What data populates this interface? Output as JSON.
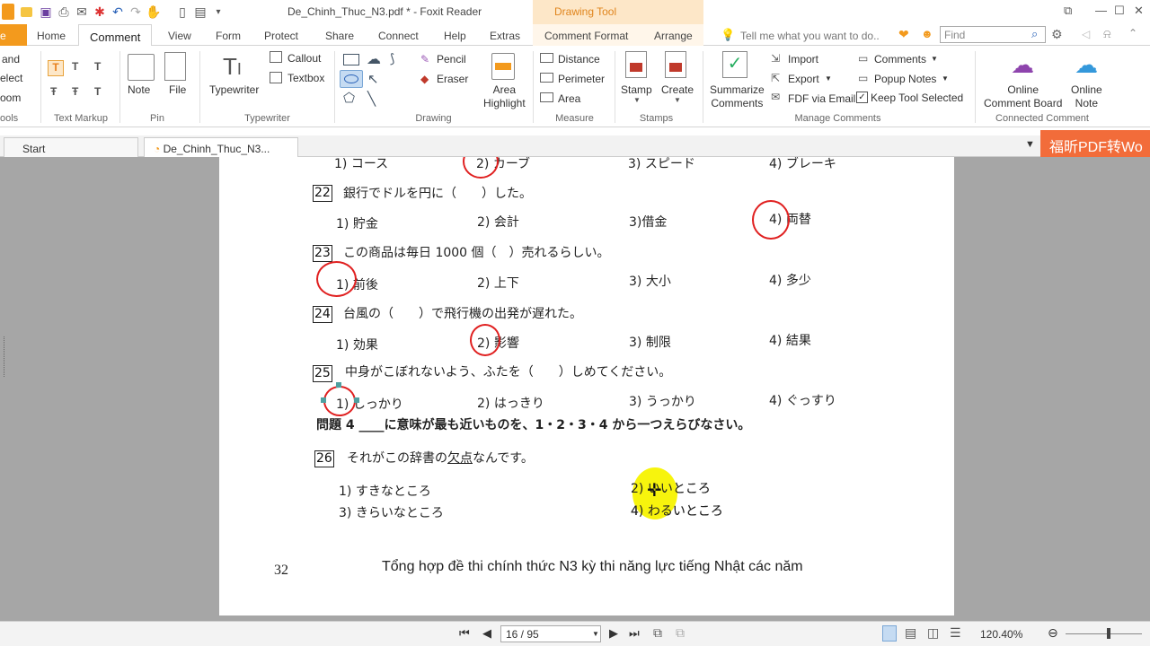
{
  "app": {
    "title": "De_Chinh_Thuc_N3.pdf * - Foxit Reader",
    "context_tab": "Drawing Tool"
  },
  "menu_tabs": [
    "e",
    "Home",
    "Comment",
    "View",
    "Form",
    "Protect",
    "Share",
    "Connect",
    "Help",
    "Extras",
    "Comment Format",
    "Arrange"
  ],
  "tell_me": "Tell me what you want to do..",
  "search": {
    "placeholder": "Find"
  },
  "ribbon": {
    "left_partial": [
      "and",
      "elect",
      "oom"
    ],
    "groups": {
      "tools": "ools",
      "text_markup": "Text Markup",
      "pin": "Pin",
      "typewriter": "Typewriter",
      "drawing": "Drawing",
      "measure": "Measure",
      "stamps": "Stamps",
      "manage_comments": "Manage Comments",
      "connected_comment": "Connected Comment"
    },
    "note": "Note",
    "file": "File",
    "typewriter_btn": "Typewriter",
    "callout": "Callout",
    "textbox": "Textbox",
    "pencil": "Pencil",
    "eraser": "Eraser",
    "area_highlight": [
      "Area",
      "Highlight"
    ],
    "distance": "Distance",
    "perimeter": "Perimeter",
    "area": "Area",
    "stamp": "Stamp",
    "create": "Create",
    "summarize": [
      "Summarize",
      "Comments"
    ],
    "import": "Import",
    "export": "Export",
    "fdf_email": "FDF via Email",
    "comments": "Comments",
    "popup_notes": "Popup Notes",
    "keep_tool": "Keep Tool Selected",
    "online_board": [
      "Online",
      "Comment Board"
    ],
    "online_note": [
      "Online",
      "Note"
    ]
  },
  "doc_tabs": {
    "start": "Start",
    "file": "De_Chinh_Thuc_N3..."
  },
  "ad_text": "福昕PDF转Wo",
  "document": {
    "top_row": [
      "1) コース",
      "2) カーブ",
      "3) スピード",
      "4) ブレーキ"
    ],
    "questions": [
      {
        "num": "22",
        "text": "銀行でドルを円に（　　）した。",
        "options": [
          "1) 貯金",
          "2) 会計",
          "3)借金",
          "4) 両替"
        ]
      },
      {
        "num": "23",
        "text": "この商品は毎日 1000 個（　）売れるらしい。",
        "options": [
          "1) 前後",
          "2) 上下",
          "3) 大小",
          "4) 多少"
        ]
      },
      {
        "num": "24",
        "text": "台風の（　　）で飛行機の出発が遅れた。",
        "options": [
          "1) 効果",
          "2) 影響",
          "3) 制限",
          "4) 結果"
        ]
      },
      {
        "num": "25",
        "text": "中身がこぼれないよう、ふたを（　　）しめてください。",
        "options": [
          "1) しっかり",
          "2) はっきり",
          "3) うっかり",
          "4) ぐっすり"
        ]
      }
    ],
    "section": "問題 4 ____に意味が最も近いものを、1・2・3・4 から一つえらびなさい。",
    "q26": {
      "num": "26",
      "text_pre": "それがこの辞書の",
      "text_u": "欠点",
      "text_post": "なんです。",
      "options": [
        "1) すきなところ",
        "2) いいところ",
        "3) きらいなところ",
        "4) わるいところ"
      ]
    },
    "page_number": "32",
    "footer": "Tổng hợp đề thi chính thức N3 kỳ thi năng lực tiếng Nhật các năm"
  },
  "status": {
    "page": "16 / 95",
    "zoom": "120.40%"
  },
  "colors": {
    "accent": "#f39a1d",
    "annotation_red": "#e02020",
    "cursor_yellow": "#f7f300"
  }
}
